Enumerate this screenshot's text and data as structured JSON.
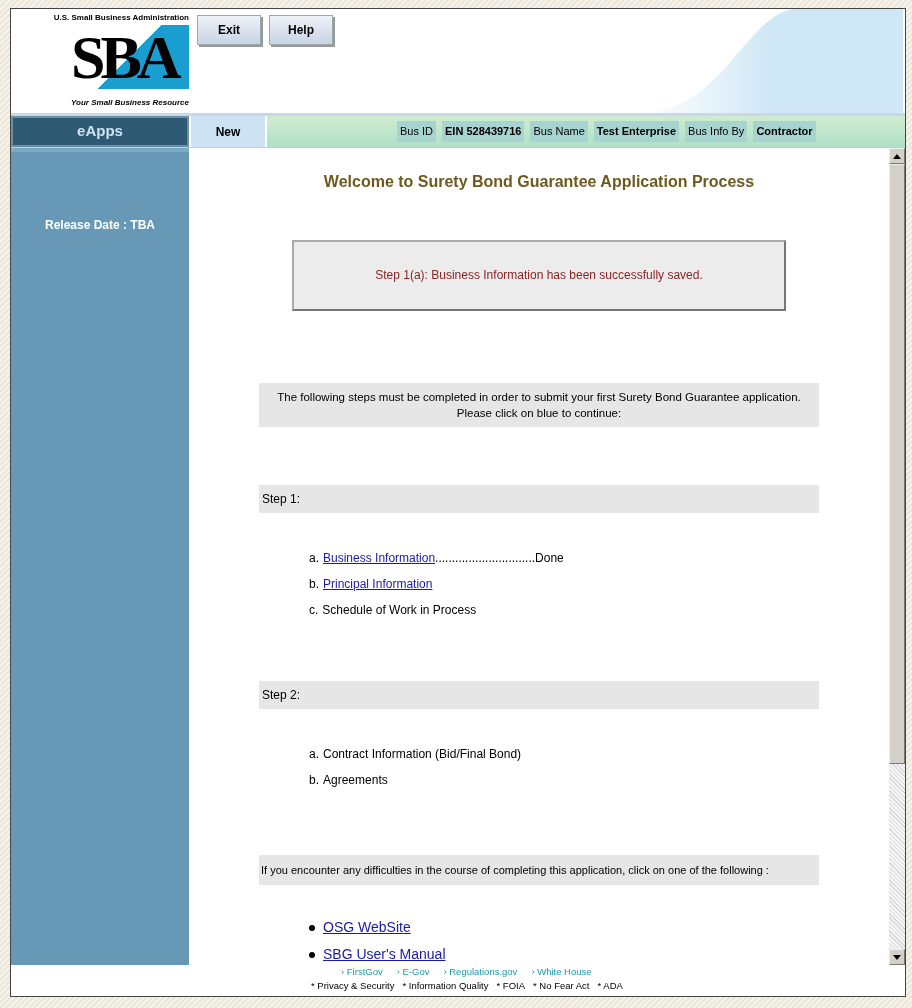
{
  "logo": {
    "agency": "U.S. Small Business Administration",
    "mark": "SBA",
    "tagline": "Your Small Business Resource"
  },
  "header_buttons": [
    "Exit",
    "Help"
  ],
  "nav": {
    "app": "eApps",
    "status": "New",
    "fields": [
      {
        "label": "Bus ID",
        "value": "EIN  528439716"
      },
      {
        "label": "Bus Name",
        "value": "Test Enterprise"
      },
      {
        "label": "Bus Info By",
        "value": "Contractor"
      }
    ]
  },
  "sidebar": {
    "release": "Release Date : TBA"
  },
  "main": {
    "title": "Welcome to Surety Bond Guarantee Application Process",
    "message": "Step 1(a): Business Information has been successfully saved.",
    "intro": [
      "The following steps must be completed in order to submit your first Surety Bond Guarantee application.",
      "Please click on blue to continue:"
    ],
    "steps": [
      {
        "heading": "Step 1:",
        "items": [
          {
            "prefix": "a.",
            "label": "Business Information",
            "link": true,
            "status": "..............................Done"
          },
          {
            "prefix": "b.",
            "label": "Principal Information",
            "link": true
          },
          {
            "prefix": "c.",
            "label": "Schedule of Work in Process",
            "link": false
          }
        ]
      },
      {
        "heading": "Step 2:",
        "items": [
          {
            "prefix": "a.",
            "label": "Contract Information (Bid/Final Bond)",
            "link": false
          },
          {
            "prefix": "b.",
            "label": "Agreements",
            "link": false
          }
        ]
      }
    ],
    "help_text": "If you encounter any difficulties in the course of completing this application, click on one of the following :",
    "help_links": [
      "OSG WebSite",
      "SBG User's Manual"
    ]
  },
  "footer": {
    "links": [
      "› FirstGov",
      "› E-Gov",
      "› Regulations.gov",
      "› White House"
    ],
    "policies": [
      "* Privacy & Security",
      "* Information Quality",
      "* FOIA",
      "* No Fear Act",
      "* ADA"
    ]
  }
}
